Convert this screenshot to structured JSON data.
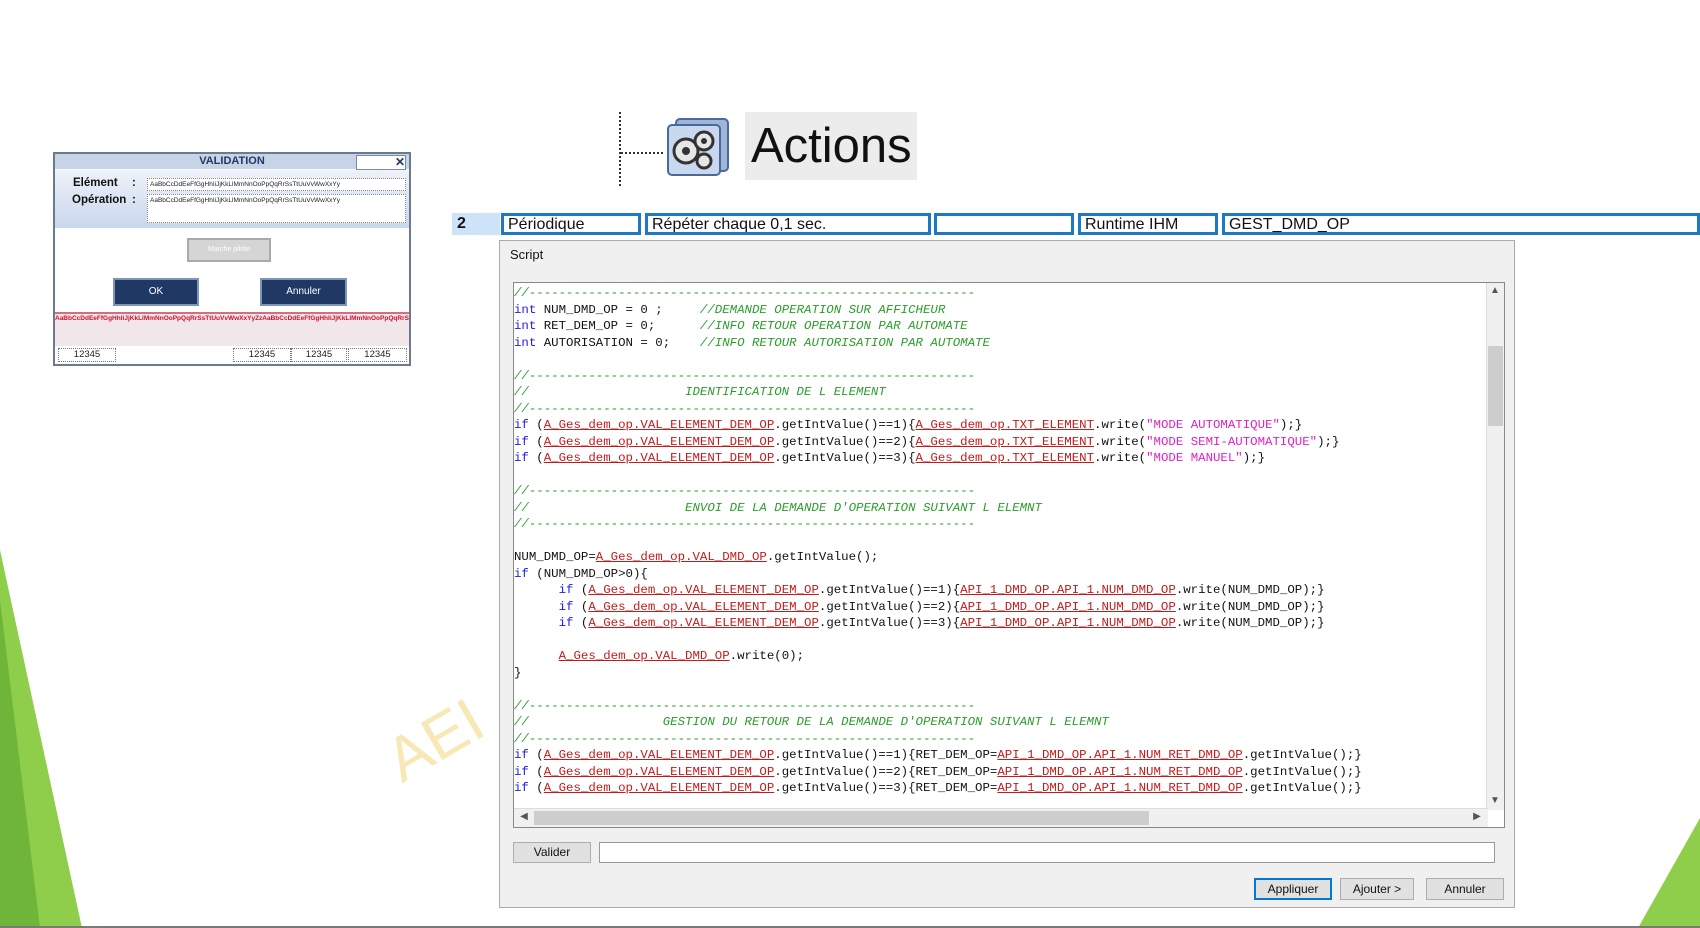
{
  "validation": {
    "title": "VALIDATION",
    "close_glyph": "✕",
    "element_label": "Elément",
    "operation_label": "Opération",
    "colon": ":",
    "element_value": "AaBbCcDdEeFfGgHhIiJjKkLlMmNnOoPpQqRrSsTtUuVvWwXxYy",
    "operation_value": "AaBbCcDdEeFfGgHhIiJjKkLlMmNnOoPpQqRrSsTtUuVvWwXxYy",
    "gray_button": "Marche pilote",
    "ok_button": "OK",
    "cancel_button": "Annuler",
    "red_text": "AaBbCcDdEeFfGgHhIiJjKkLlMmNnOoPpQqRrSsTtUuVvWwXxYyZzAaBbCcDdEeFfGgHhIiJjKkLlMmNnOoPpQqRrSsTtUuVvWwXxYyZzAaBbCcDdEeFfGgHhIiJjKkLlMmNnOoPpQqRrSsTtUuVvWwXxYyZzAaBbCcDdEeFf",
    "status": [
      "12345",
      "12345",
      "12345",
      "12345"
    ]
  },
  "actions": {
    "label": "Actions",
    "icon": "gears-icon"
  },
  "row": {
    "number": "2",
    "type": "Périodique",
    "repeat": "Répéter chaque 0,1 sec.",
    "empty": "",
    "target": "Runtime IHM",
    "name": "GEST_DMD_OP"
  },
  "script": {
    "title": "Script",
    "validate_button": "Valider",
    "apply_button": "Appliquer",
    "add_button": "Ajouter >",
    "cancel_button": "Annuler",
    "code_lines": [
      "//------------------------------------------------------------",
      "int NUM_DMD_OP = 0 ;     //DEMANDE OPERATION SUR AFFICHEUR",
      "int RET_DEM_OP = 0;      //INFO RETOUR OPERATION PAR AUTOMATE",
      "int AUTORISATION = 0;    //INFO RETOUR AUTORISATION PAR AUTOMATE",
      "",
      "//------------------------------------------------------------",
      "//                     IDENTIFICATION DE L ELEMENT",
      "//------------------------------------------------------------",
      "if (A_Ges_dem_op.VAL_ELEMENT_DEM_OP.getIntValue()==1){A_Ges_dem_op.TXT_ELEMENT.write(\"MODE AUTOMATIQUE\");}",
      "if (A_Ges_dem_op.VAL_ELEMENT_DEM_OP.getIntValue()==2){A_Ges_dem_op.TXT_ELEMENT.write(\"MODE SEMI-AUTOMATIQUE\");}",
      "if (A_Ges_dem_op.VAL_ELEMENT_DEM_OP.getIntValue()==3){A_Ges_dem_op.TXT_ELEMENT.write(\"MODE MANUEL\");}",
      "",
      "//------------------------------------------------------------",
      "//                     ENVOI DE LA DEMANDE D'OPERATION SUIVANT L ELEMNT",
      "//------------------------------------------------------------",
      "",
      "NUM_DMD_OP=A_Ges_dem_op.VAL_DMD_OP.getIntValue();",
      "if (NUM_DMD_OP>0){",
      "      if (A_Ges_dem_op.VAL_ELEMENT_DEM_OP.getIntValue()==1){API_1_DMD_OP.API_1.NUM_DMD_OP.write(NUM_DMD_OP);}",
      "      if (A_Ges_dem_op.VAL_ELEMENT_DEM_OP.getIntValue()==2){API_1_DMD_OP.API_1.NUM_DMD_OP.write(NUM_DMD_OP);}",
      "      if (A_Ges_dem_op.VAL_ELEMENT_DEM_OP.getIntValue()==3){API_1_DMD_OP.API_1.NUM_DMD_OP.write(NUM_DMD_OP);}",
      "",
      "      A_Ges_dem_op.VAL_DMD_OP.write(0);",
      "}",
      "",
      "//------------------------------------------------------------",
      "//                  GESTION DU RETOUR DE LA DEMANDE D'OPERATION SUIVANT L ELEMNT",
      "//------------------------------------------------------------",
      "if (A_Ges_dem_op.VAL_ELEMENT_DEM_OP.getIntValue()==1){RET_DEM_OP=API_1_DMD_OP.API_1.NUM_RET_DMD_OP.getIntValue();}",
      "if (A_Ges_dem_op.VAL_ELEMENT_DEM_OP.getIntValue()==2){RET_DEM_OP=API_1_DMD_OP.API_1.NUM_RET_DMD_OP.getIntValue();}",
      "if (A_Ges_dem_op.VAL_ELEMENT_DEM_OP.getIntValue()==3){RET_DEM_OP=API_1_DMD_OP.API_1.NUM_RET_DMD_OP.getIntValue();}"
    ]
  },
  "watermark": "AEI"
}
